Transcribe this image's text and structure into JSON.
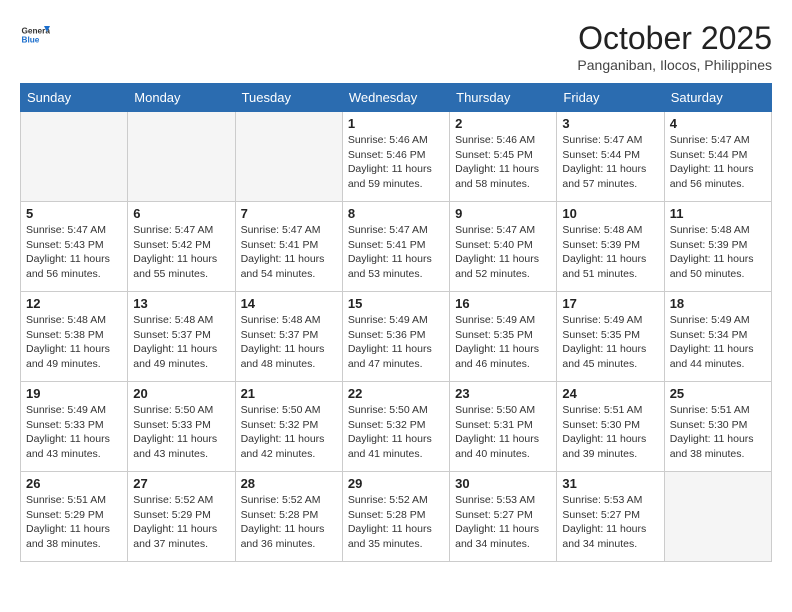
{
  "header": {
    "logo": {
      "general": "General",
      "blue": "Blue"
    },
    "month": "October 2025",
    "location": "Panganiban, Ilocos, Philippines"
  },
  "weekdays": [
    "Sunday",
    "Monday",
    "Tuesday",
    "Wednesday",
    "Thursday",
    "Friday",
    "Saturday"
  ],
  "weeks": [
    [
      {
        "day": "",
        "info": ""
      },
      {
        "day": "",
        "info": ""
      },
      {
        "day": "",
        "info": ""
      },
      {
        "day": "1",
        "info": "Sunrise: 5:46 AM\nSunset: 5:46 PM\nDaylight: 11 hours\nand 59 minutes."
      },
      {
        "day": "2",
        "info": "Sunrise: 5:46 AM\nSunset: 5:45 PM\nDaylight: 11 hours\nand 58 minutes."
      },
      {
        "day": "3",
        "info": "Sunrise: 5:47 AM\nSunset: 5:44 PM\nDaylight: 11 hours\nand 57 minutes."
      },
      {
        "day": "4",
        "info": "Sunrise: 5:47 AM\nSunset: 5:44 PM\nDaylight: 11 hours\nand 56 minutes."
      }
    ],
    [
      {
        "day": "5",
        "info": "Sunrise: 5:47 AM\nSunset: 5:43 PM\nDaylight: 11 hours\nand 56 minutes."
      },
      {
        "day": "6",
        "info": "Sunrise: 5:47 AM\nSunset: 5:42 PM\nDaylight: 11 hours\nand 55 minutes."
      },
      {
        "day": "7",
        "info": "Sunrise: 5:47 AM\nSunset: 5:41 PM\nDaylight: 11 hours\nand 54 minutes."
      },
      {
        "day": "8",
        "info": "Sunrise: 5:47 AM\nSunset: 5:41 PM\nDaylight: 11 hours\nand 53 minutes."
      },
      {
        "day": "9",
        "info": "Sunrise: 5:47 AM\nSunset: 5:40 PM\nDaylight: 11 hours\nand 52 minutes."
      },
      {
        "day": "10",
        "info": "Sunrise: 5:48 AM\nSunset: 5:39 PM\nDaylight: 11 hours\nand 51 minutes."
      },
      {
        "day": "11",
        "info": "Sunrise: 5:48 AM\nSunset: 5:39 PM\nDaylight: 11 hours\nand 50 minutes."
      }
    ],
    [
      {
        "day": "12",
        "info": "Sunrise: 5:48 AM\nSunset: 5:38 PM\nDaylight: 11 hours\nand 49 minutes."
      },
      {
        "day": "13",
        "info": "Sunrise: 5:48 AM\nSunset: 5:37 PM\nDaylight: 11 hours\nand 49 minutes."
      },
      {
        "day": "14",
        "info": "Sunrise: 5:48 AM\nSunset: 5:37 PM\nDaylight: 11 hours\nand 48 minutes."
      },
      {
        "day": "15",
        "info": "Sunrise: 5:49 AM\nSunset: 5:36 PM\nDaylight: 11 hours\nand 47 minutes."
      },
      {
        "day": "16",
        "info": "Sunrise: 5:49 AM\nSunset: 5:35 PM\nDaylight: 11 hours\nand 46 minutes."
      },
      {
        "day": "17",
        "info": "Sunrise: 5:49 AM\nSunset: 5:35 PM\nDaylight: 11 hours\nand 45 minutes."
      },
      {
        "day": "18",
        "info": "Sunrise: 5:49 AM\nSunset: 5:34 PM\nDaylight: 11 hours\nand 44 minutes."
      }
    ],
    [
      {
        "day": "19",
        "info": "Sunrise: 5:49 AM\nSunset: 5:33 PM\nDaylight: 11 hours\nand 43 minutes."
      },
      {
        "day": "20",
        "info": "Sunrise: 5:50 AM\nSunset: 5:33 PM\nDaylight: 11 hours\nand 43 minutes."
      },
      {
        "day": "21",
        "info": "Sunrise: 5:50 AM\nSunset: 5:32 PM\nDaylight: 11 hours\nand 42 minutes."
      },
      {
        "day": "22",
        "info": "Sunrise: 5:50 AM\nSunset: 5:32 PM\nDaylight: 11 hours\nand 41 minutes."
      },
      {
        "day": "23",
        "info": "Sunrise: 5:50 AM\nSunset: 5:31 PM\nDaylight: 11 hours\nand 40 minutes."
      },
      {
        "day": "24",
        "info": "Sunrise: 5:51 AM\nSunset: 5:30 PM\nDaylight: 11 hours\nand 39 minutes."
      },
      {
        "day": "25",
        "info": "Sunrise: 5:51 AM\nSunset: 5:30 PM\nDaylight: 11 hours\nand 38 minutes."
      }
    ],
    [
      {
        "day": "26",
        "info": "Sunrise: 5:51 AM\nSunset: 5:29 PM\nDaylight: 11 hours\nand 38 minutes."
      },
      {
        "day": "27",
        "info": "Sunrise: 5:52 AM\nSunset: 5:29 PM\nDaylight: 11 hours\nand 37 minutes."
      },
      {
        "day": "28",
        "info": "Sunrise: 5:52 AM\nSunset: 5:28 PM\nDaylight: 11 hours\nand 36 minutes."
      },
      {
        "day": "29",
        "info": "Sunrise: 5:52 AM\nSunset: 5:28 PM\nDaylight: 11 hours\nand 35 minutes."
      },
      {
        "day": "30",
        "info": "Sunrise: 5:53 AM\nSunset: 5:27 PM\nDaylight: 11 hours\nand 34 minutes."
      },
      {
        "day": "31",
        "info": "Sunrise: 5:53 AM\nSunset: 5:27 PM\nDaylight: 11 hours\nand 34 minutes."
      },
      {
        "day": "",
        "info": ""
      }
    ]
  ]
}
